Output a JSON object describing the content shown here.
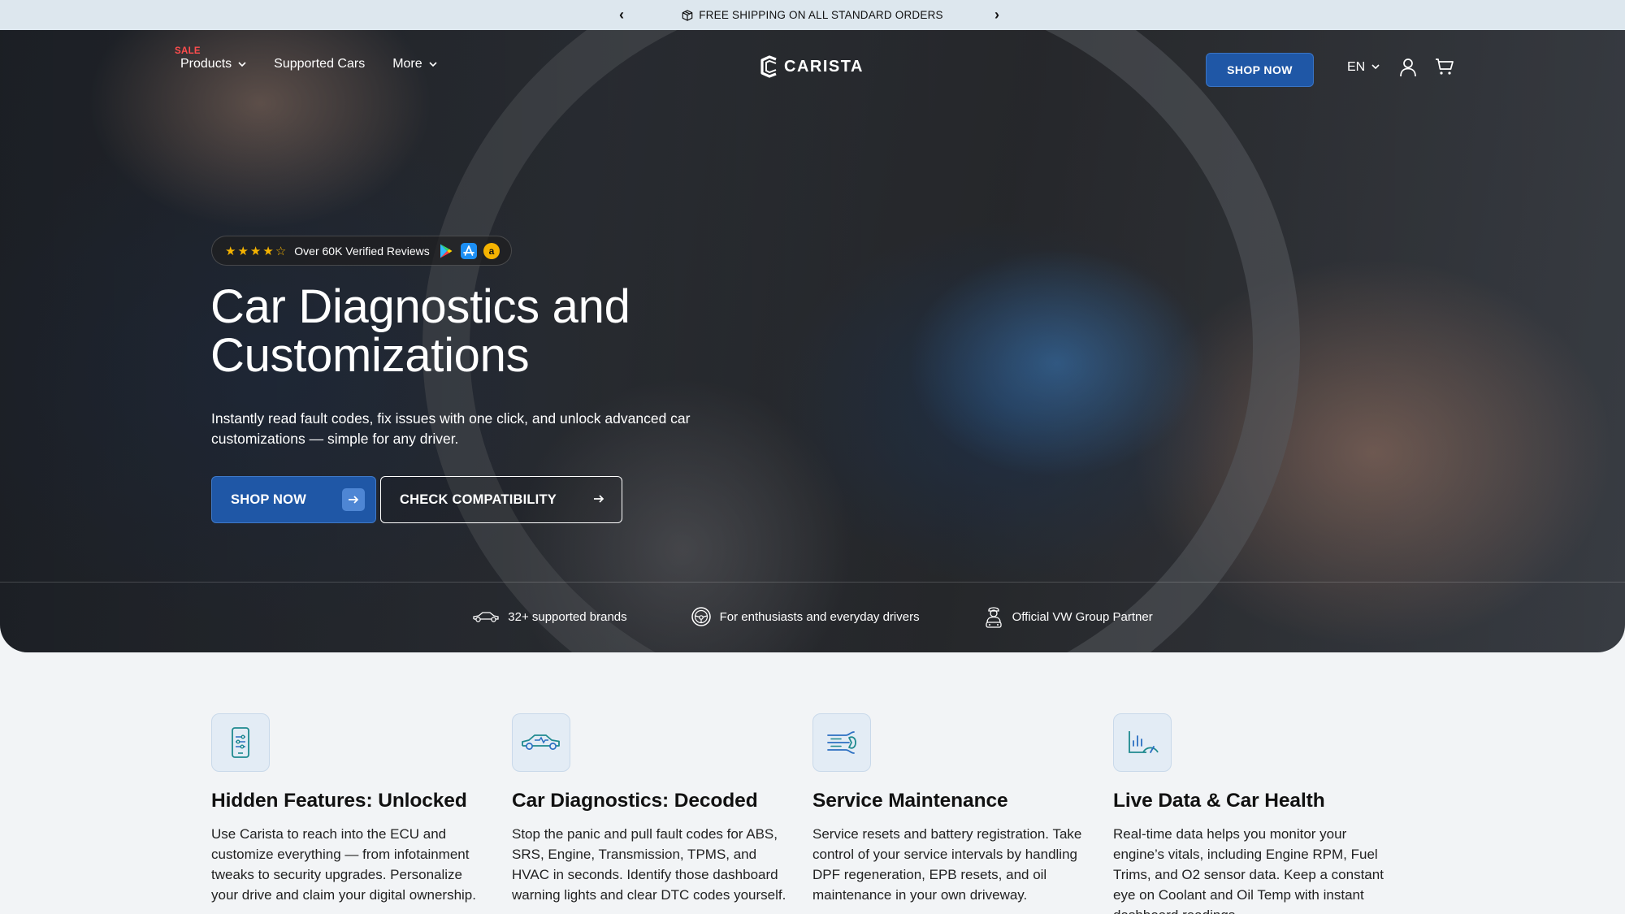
{
  "announcement": {
    "text": "FREE SHIPPING ON ALL STANDARD ORDERS",
    "prev": "‹",
    "next": "›",
    "icon": "box-icon"
  },
  "nav": {
    "sale_tag": "SALE",
    "items": [
      {
        "label": "Products",
        "dropdown": true
      },
      {
        "label": "Supported Cars",
        "dropdown": false
      },
      {
        "label": "More",
        "dropdown": true
      }
    ]
  },
  "logo": {
    "text": "CARISTA"
  },
  "header": {
    "cta_label": "SHOP NOW",
    "language": "EN"
  },
  "hero": {
    "reviews_text": "Over 60K Verified Reviews",
    "rating_stars": 4,
    "title": "Car Diagnostics and Customizations",
    "subtitle": "Instantly read fault codes, fix issues with one click, and unlock advanced car customizations — simple for any driver.",
    "primary_cta": "SHOP NOW",
    "secondary_cta": "CHECK COMPATIBILITY"
  },
  "feature_strip": [
    {
      "icon": "car-icon",
      "label": "32+ supported brands"
    },
    {
      "icon": "steering-wheel-icon",
      "label": "For enthusiasts and everyday drivers"
    },
    {
      "icon": "mechanic-icon",
      "label": "Official VW Group Partner"
    }
  ],
  "features": [
    {
      "icon": "phone-settings-icon",
      "title": "Hidden Features: Unlocked",
      "description": "Use Carista to reach into the ECU and customize everything — from infotainment tweaks to security upgrades. Personalize your drive and claim your digital ownership."
    },
    {
      "icon": "car-diagnostics-icon",
      "title": "Car Diagnostics: Decoded",
      "description": "Stop the panic and pull fault codes for ABS, SRS, Engine, Transmission, TPMS, and HVAC in seconds. Identify those dashboard warning lights and clear DTC codes yourself."
    },
    {
      "icon": "wrench-icon",
      "title": "Service Maintenance",
      "description": "Service resets and battery registration. Take control of your service intervals by handling DPF regeneration, EPB resets, and oil maintenance in your own driveway."
    },
    {
      "icon": "gauge-chart-icon",
      "title": "Live Data & Car Health",
      "description": "Real-time data helps you monitor your engine’s vitals, including Engine RPM, Fuel Trims, and O2 sensor data. Keep a constant eye on Coolant and Oil Temp with instant dashboard readings."
    }
  ],
  "colors": {
    "primary": "#1f57a6",
    "announcement_bg": "#dde7ee",
    "sale": "#ff4d4d",
    "star": "#f5b301",
    "icon_teal": "#1f8a8f"
  }
}
